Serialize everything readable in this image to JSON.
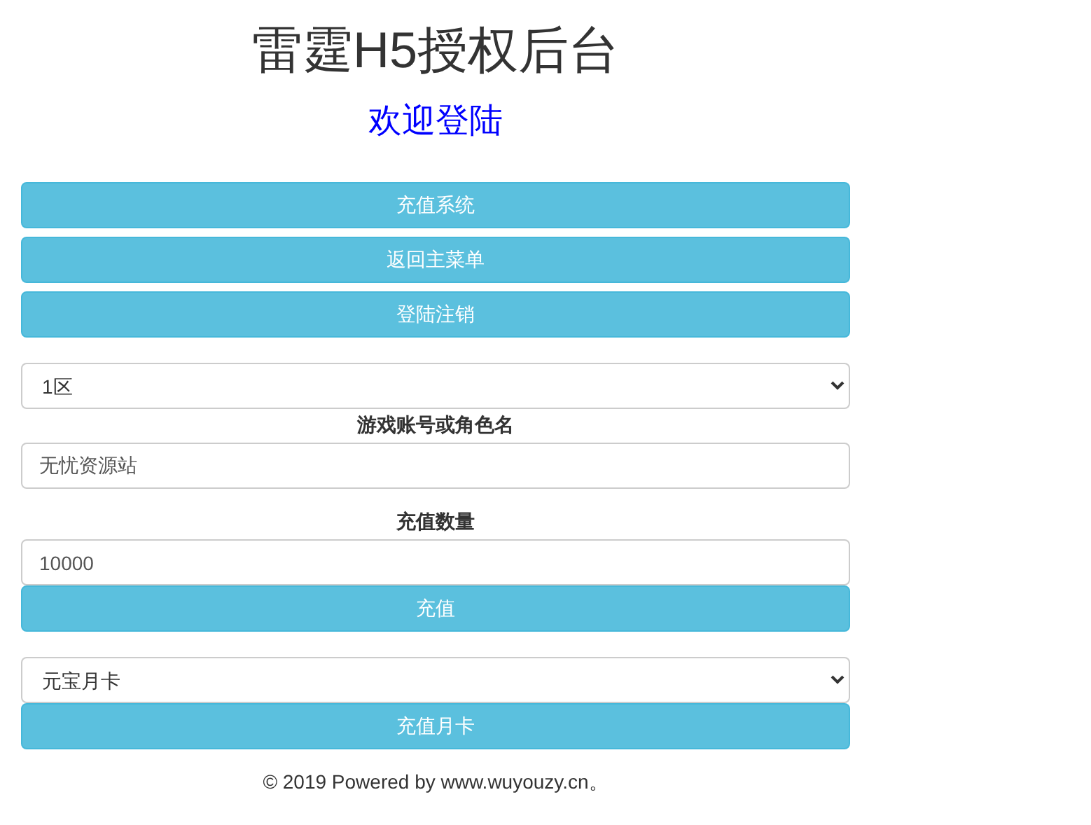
{
  "header": {
    "title": "雷霆H5授权后台",
    "subtitle": "欢迎登陆"
  },
  "nav_buttons": [
    "充值系统",
    "返回主菜单",
    "登陆注销"
  ],
  "server_select": {
    "value": "1区"
  },
  "account": {
    "label": "游戏账号或角色名",
    "value": "无忧资源站"
  },
  "amount": {
    "label": "充值数量",
    "value": "10000"
  },
  "recharge_button": "充值",
  "card_select": {
    "value": "元宝月卡"
  },
  "card_button": "充值月卡",
  "footer": "© 2019 Powered by www.wuyouzy.cn。"
}
